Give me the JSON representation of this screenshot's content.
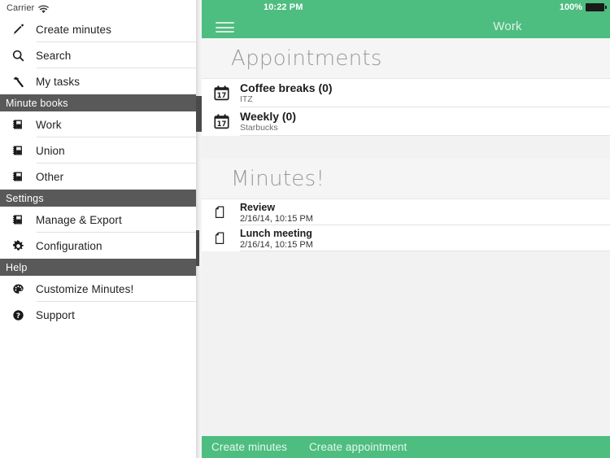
{
  "status_bar": {
    "carrier": "Carrier",
    "wifi_icon": "wifi-icon",
    "time": "10:22 PM",
    "battery_percent": "100%",
    "battery_icon": "battery-full-icon"
  },
  "sidebar": {
    "groups": [
      {
        "header": null,
        "items": [
          {
            "label": "Create minutes",
            "icon": "pencil-icon"
          },
          {
            "label": "Search",
            "icon": "search-icon"
          },
          {
            "label": "My tasks",
            "icon": "hammer-icon"
          }
        ]
      },
      {
        "header": "Minute books",
        "items": [
          {
            "label": "Work",
            "icon": "notebook-icon"
          },
          {
            "label": "Union",
            "icon": "notebook-icon"
          },
          {
            "label": "Other",
            "icon": "notebook-icon"
          }
        ]
      },
      {
        "header": "Settings",
        "items": [
          {
            "label": "Manage & Export",
            "icon": "notebook-icon"
          },
          {
            "label": "Configuration",
            "icon": "gear-icon"
          }
        ]
      },
      {
        "header": "Help",
        "items": [
          {
            "label": "Customize Minutes!",
            "icon": "palette-icon"
          },
          {
            "label": "Support",
            "icon": "question-circle-icon"
          }
        ]
      }
    ]
  },
  "navbar": {
    "menu_icon": "hamburger-menu-icon",
    "title": "Work"
  },
  "sections": [
    {
      "title": "Appointments",
      "items": [
        {
          "title": "Coffee breaks (0)",
          "subtitle": "ITZ",
          "icon": "calendar-icon",
          "icon_day": "17"
        },
        {
          "title": "Weekly (0)",
          "subtitle": "Starbucks",
          "icon": "calendar-icon",
          "icon_day": "17"
        }
      ]
    },
    {
      "title": "Minutes!",
      "items": [
        {
          "title": "Review",
          "subtitle": "2/16/14, 10:15 PM",
          "icon": "document-icon"
        },
        {
          "title": "Lunch meeting",
          "subtitle": "2/16/14, 10:15 PM",
          "icon": "document-icon"
        }
      ]
    }
  ],
  "toolbar": {
    "create_minutes_label": "Create minutes",
    "create_appointment_label": "Create appointment"
  },
  "colors": {
    "accent_green": "#4ebd80",
    "section_header_gray": "#595959",
    "detail_background": "#f2f2f2"
  }
}
